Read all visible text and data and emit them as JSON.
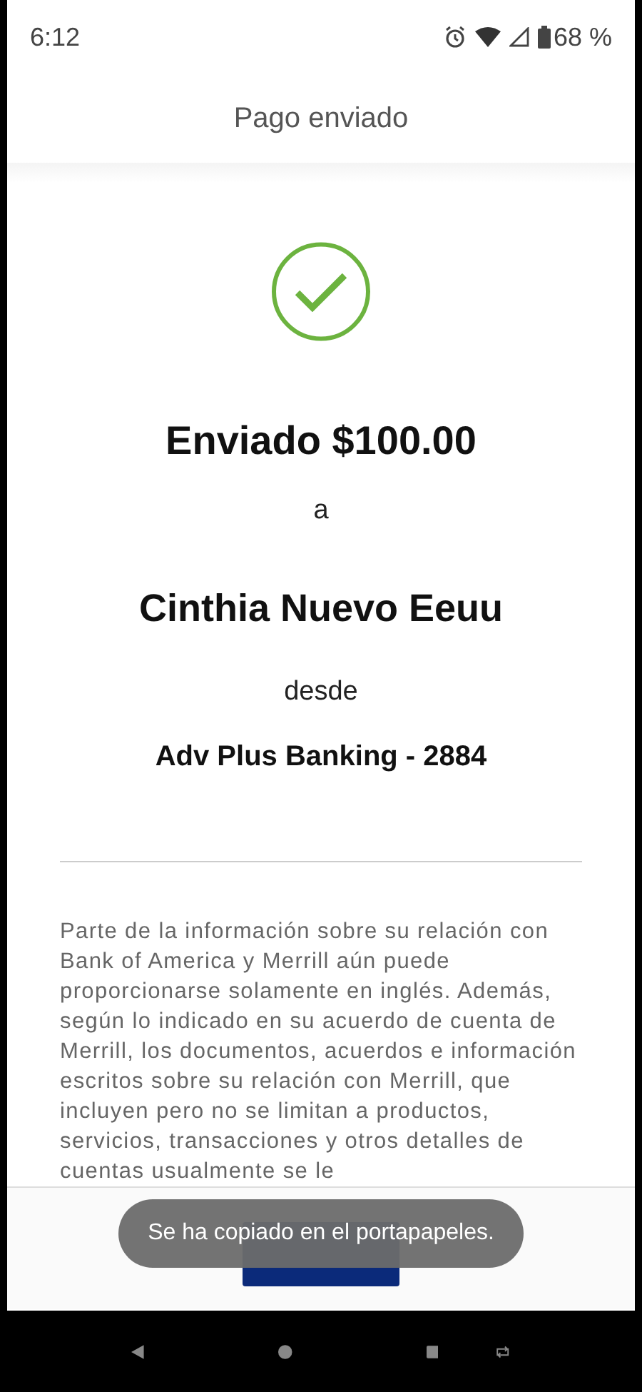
{
  "status_bar": {
    "time": "6:12",
    "battery": "68 %"
  },
  "header": {
    "title": "Pago enviado"
  },
  "confirmation": {
    "amount_line": "Enviado $100.00",
    "to_word": "a",
    "recipient": "Cinthia Nuevo Eeuu",
    "from_word": "desde",
    "account": "Adv Plus Banking - 2884"
  },
  "disclaimer": "Parte de la información sobre su relación con Bank of America y Merrill aún puede proporcionarse solamente en inglés. Además, según lo indicado en su acuerdo de cuenta de Merrill, los documentos, acuerdos e información escritos sobre su relación con Merrill, que incluyen pero no se limitan a productos, servicios, transacciones y otros detalles de cuentas usualmente se le",
  "toast": "Se ha copiado en el portapapeles."
}
